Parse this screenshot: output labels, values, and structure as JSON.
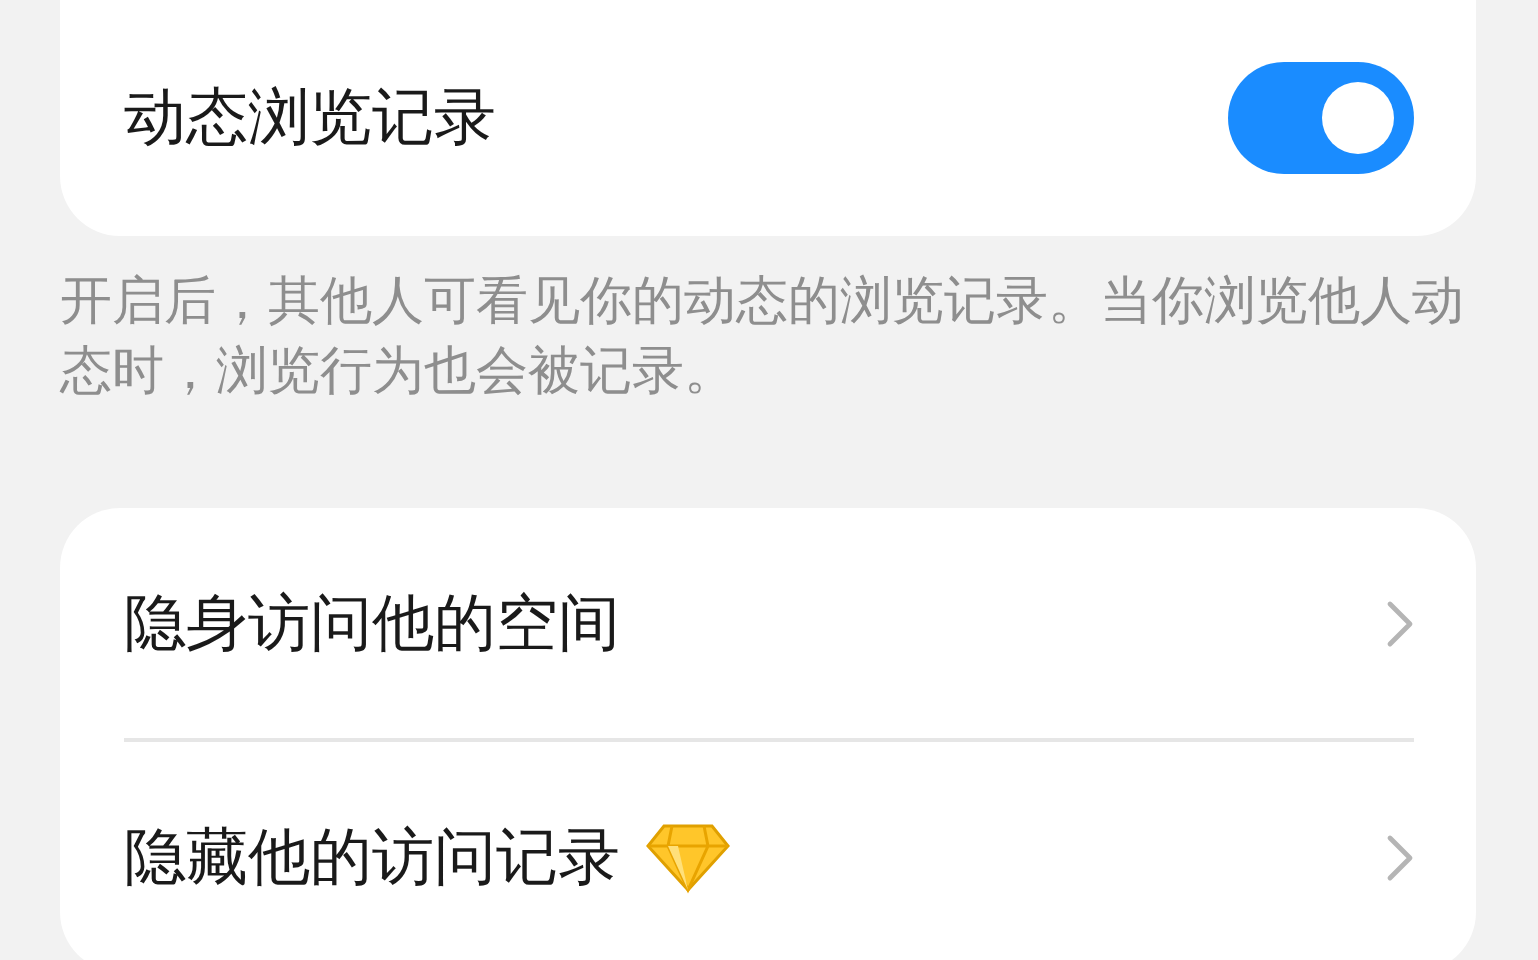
{
  "browse_record": {
    "label": "动态浏览记录",
    "on": true
  },
  "description": "开启后，其他人可看见你的动态的浏览记录。当你浏览他人动态时，浏览行为也会被记录。",
  "options": [
    {
      "label": "隐身访问他的空间",
      "premium": false
    },
    {
      "label": "隐藏他的访问记录",
      "premium": true
    }
  ]
}
